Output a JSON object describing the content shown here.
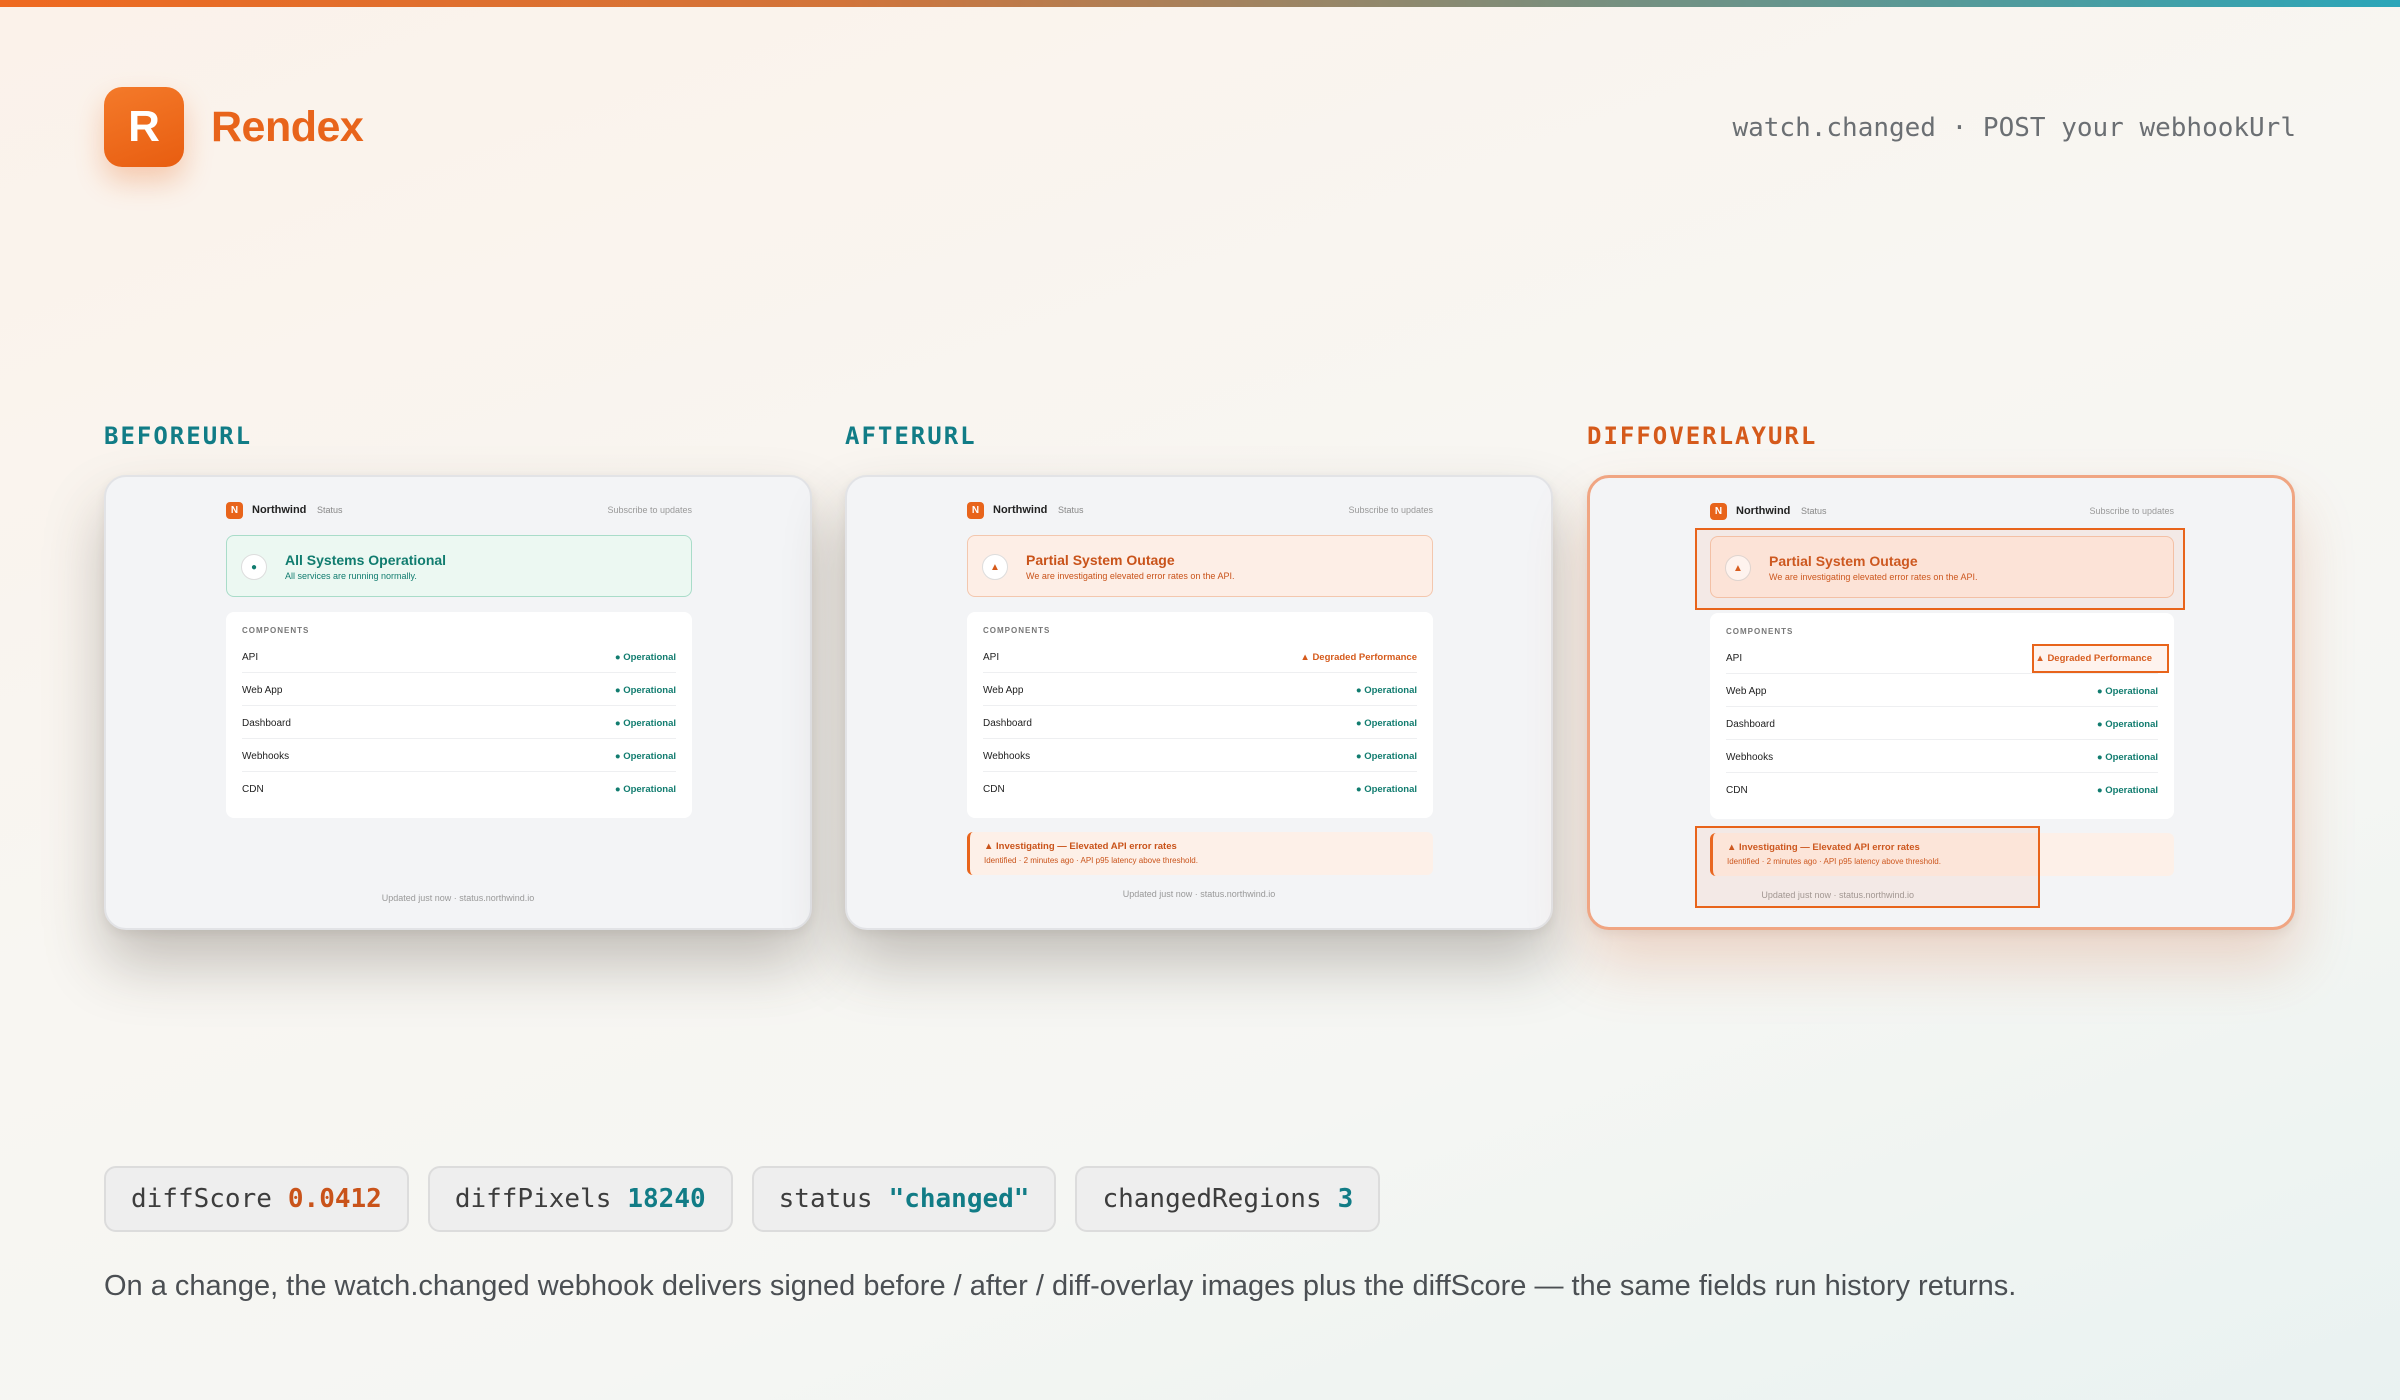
{
  "brand": {
    "mark": "R",
    "name": "Rendex"
  },
  "event_line": "watch.changed · POST your webhookUrl",
  "panels": [
    {
      "label": "BEFOREURL",
      "header": {
        "logo": "N",
        "name": "Northwind",
        "status": "Status",
        "subscribe": "Subscribe to updates"
      },
      "banner": {
        "state": "ok",
        "icon": "●",
        "title": "All Systems Operational",
        "desc": "All services are running normally."
      },
      "components_heading": "COMPONENTS",
      "components": [
        {
          "name": "API",
          "status": "● Operational"
        },
        {
          "name": "Web App",
          "status": "● Operational"
        },
        {
          "name": "Dashboard",
          "status": "● Operational"
        },
        {
          "name": "Webhooks",
          "status": "● Operational"
        },
        {
          "name": "CDN",
          "status": "● Operational"
        }
      ],
      "footer": "Updated just now · status.northwind.io"
    },
    {
      "label": "AFTERURL",
      "header": {
        "logo": "N",
        "name": "Northwind",
        "status": "Status",
        "subscribe": "Subscribe to updates"
      },
      "banner": {
        "state": "bad",
        "icon": "▲",
        "title": "Partial System Outage",
        "desc": "We are investigating elevated error rates on the API."
      },
      "components_heading": "COMPONENTS",
      "components": [
        {
          "name": "API",
          "status": "▲ Degraded Performance"
        },
        {
          "name": "Web App",
          "status": "● Operational"
        },
        {
          "name": "Dashboard",
          "status": "● Operational"
        },
        {
          "name": "Webhooks",
          "status": "● Operational"
        },
        {
          "name": "CDN",
          "status": "● Operational"
        }
      ],
      "incident": {
        "title": "▲ Investigating — Elevated API error rates",
        "desc": "Identified · 2 minutes ago · API p95 latency above threshold."
      },
      "footer": "Updated just now · status.northwind.io"
    },
    {
      "label": "DIFFOVERLAYURL",
      "header": {
        "logo": "N",
        "name": "Northwind",
        "status": "Status",
        "subscribe": "Subscribe to updates"
      },
      "banner": {
        "state": "bad",
        "icon": "▲",
        "title": "Partial System Outage",
        "desc": "We are investigating elevated error rates on the API."
      },
      "components_heading": "COMPONENTS",
      "components": [
        {
          "name": "API",
          "status": "▲ Degraded Performance"
        },
        {
          "name": "Web App",
          "status": "● Operational"
        },
        {
          "name": "Dashboard",
          "status": "● Operational"
        },
        {
          "name": "Webhooks",
          "status": "● Operational"
        },
        {
          "name": "CDN",
          "status": "● Operational"
        }
      ],
      "incident": {
        "title": "▲ Investigating — Elevated API error rates",
        "desc": "Identified · 2 minutes ago · API p95 latency above threshold."
      },
      "footer": "Updated just now · status.northwind.io"
    }
  ],
  "chips": [
    {
      "key": "diffScore",
      "value": "0.0412"
    },
    {
      "key": "diffPixels",
      "value": "18240"
    },
    {
      "key": "status",
      "value": "\"changed\""
    },
    {
      "key": "changedRegions",
      "value": "3"
    }
  ],
  "caption": "On a change, the watch.changed webhook delivers signed before / after / diff-overlay images plus the diffScore — the same fields run history returns.",
  "colors": {
    "accent": "#e8641b",
    "teal": "#117c86",
    "operational": "#117c6f"
  }
}
